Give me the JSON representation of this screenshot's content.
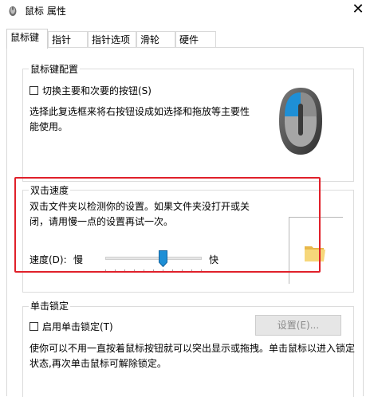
{
  "window": {
    "title": "鼠标 属性",
    "close_glyph": "✕",
    "icon": "mouse-app-icon"
  },
  "tabs": [
    {
      "label": "鼠标键",
      "active": true
    },
    {
      "label": "指针",
      "active": false
    },
    {
      "label": "指针选项",
      "active": false
    },
    {
      "label": "滑轮",
      "active": false
    },
    {
      "label": "硬件",
      "active": false
    }
  ],
  "button_config": {
    "legend": "鼠标键配置",
    "switch_label": "切换主要和次要的按钮(S)",
    "switch_checked": false,
    "description": "选择此复选框来将右按钮设成如选择和拖放等主要性能使用。",
    "mouse_icon": "mouse-icon"
  },
  "double_click": {
    "legend": "双击速度",
    "description": "双击文件夹以检测你的设置。如果文件夹没打开或关闭，请用慢一点的设置再试一次。",
    "speed_label": "速度(D):",
    "slow_label": "慢",
    "fast_label": "快",
    "speed_fraction": 0.6,
    "folder_icon": "folder-icon"
  },
  "click_lock": {
    "legend": "单击锁定",
    "enable_label": "启用单击锁定(T)",
    "enable_checked": false,
    "settings_label": "设置(E)...",
    "settings_enabled": false,
    "description": "使你可以不用一直按着鼠标按钮就可以突出显示或拖拽。单击鼠标以进入锁定状态,再次单击鼠标可解除锁定。"
  },
  "colors": {
    "highlight": "#e0202a",
    "accent_blue": "#1e8fd6",
    "disabled_text": "#8a8a8a"
  }
}
